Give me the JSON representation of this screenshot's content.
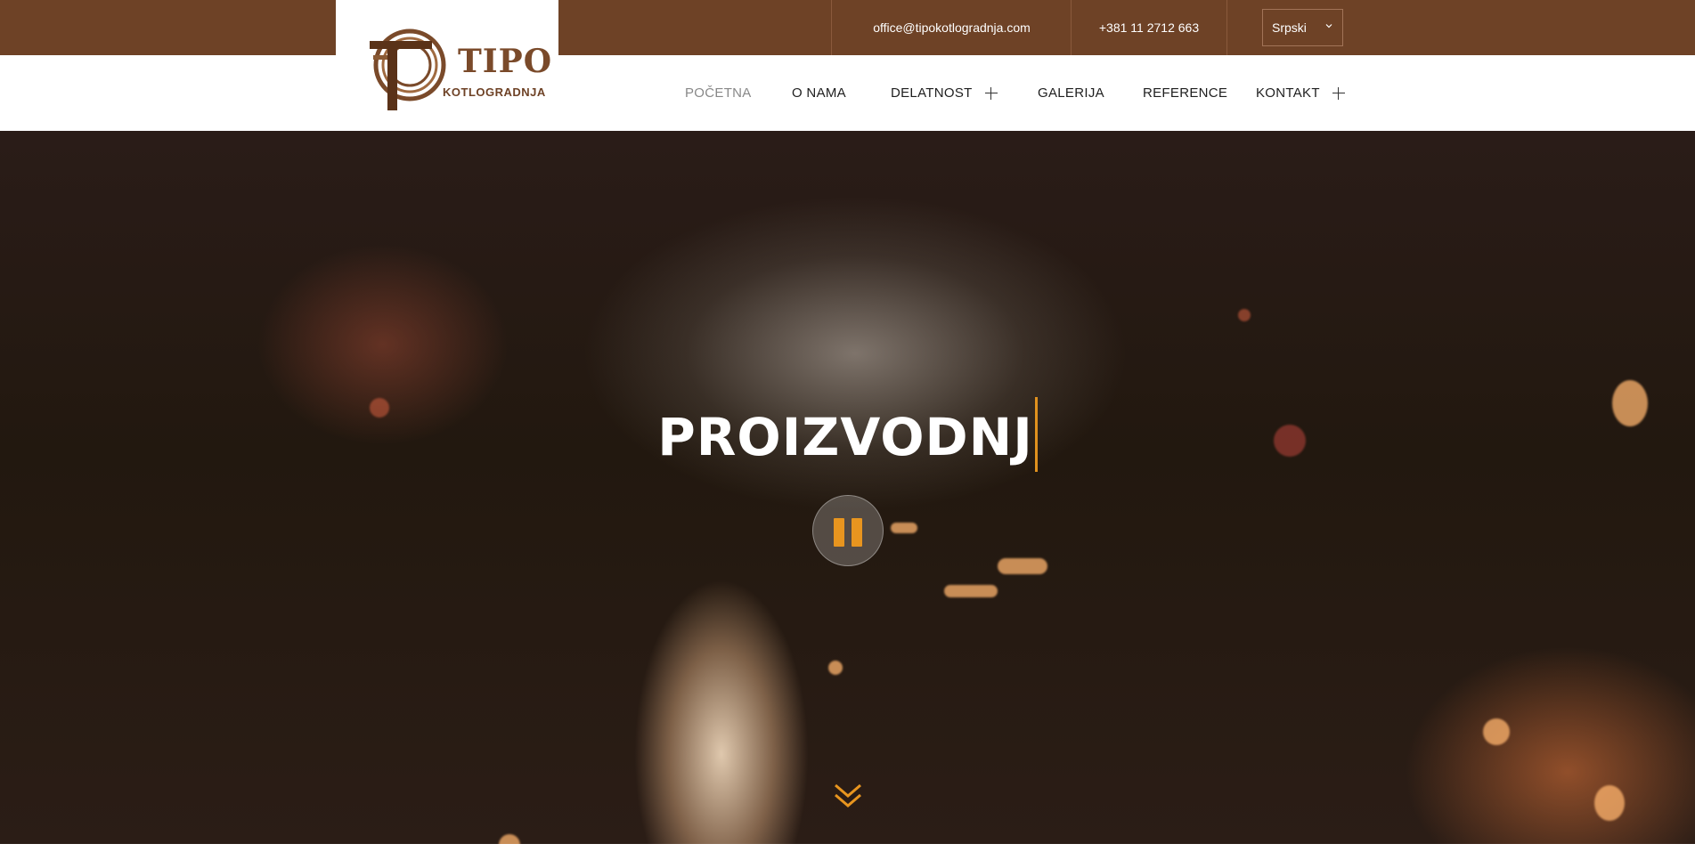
{
  "topbar": {
    "email": "office@tipokotlogradnja.com",
    "phone": "+381 11 2712 663",
    "language": "Srpski"
  },
  "logo": {
    "word": "TIPO",
    "subtitle": "KOTLOGRADNJA"
  },
  "nav": {
    "items": [
      {
        "label": "POČETNA",
        "active": true,
        "submenu": false
      },
      {
        "label": "O NAMA",
        "active": false,
        "submenu": false
      },
      {
        "label": "DELATNOST",
        "active": false,
        "submenu": true
      },
      {
        "label": "GALERIJA",
        "active": false,
        "submenu": false
      },
      {
        "label": "REFERENCE",
        "active": false,
        "submenu": false
      },
      {
        "label": "KONTAKT",
        "active": false,
        "submenu": true
      }
    ]
  },
  "hero": {
    "typed_text": "PROIZVODNJ",
    "pause_icon": "pause-icon",
    "scroll_icon": "double-chevron-down-icon"
  },
  "colors": {
    "brand_brown": "#6e4226",
    "accent_orange": "#e8951f",
    "nav_text": "#1e1e1e",
    "nav_active": "#888888"
  }
}
